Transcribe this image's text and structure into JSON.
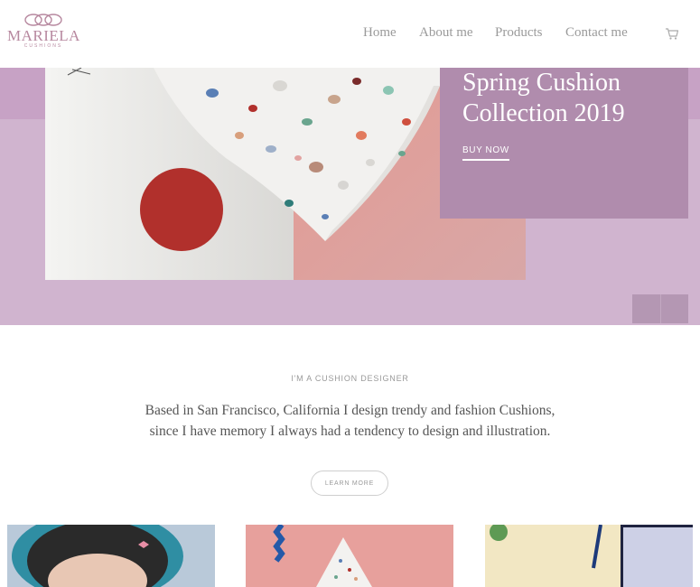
{
  "brand": {
    "name": "MARIELA",
    "tagline": "CUSHIONS"
  },
  "nav": {
    "items": [
      {
        "label": "Home"
      },
      {
        "label": "About me"
      },
      {
        "label": "Products"
      },
      {
        "label": "Contact me"
      }
    ],
    "cart_icon": "cart-icon"
  },
  "hero": {
    "title_line1": "Spring Cushion",
    "title_line2": "Collection 2019",
    "cta": "BUY NOW"
  },
  "intro": {
    "eyebrow": "I'M A CUSHION DESIGNER",
    "text": "Based in San Francisco, California I design trendy and fashion Cushions, since I have memory I always had a tendency to design and illustration.",
    "cta": "LEARN MORE"
  },
  "colors": {
    "accent": "#b08cad",
    "hero_bg": "#d0b4cf",
    "nav_text": "#9a9a9a"
  }
}
